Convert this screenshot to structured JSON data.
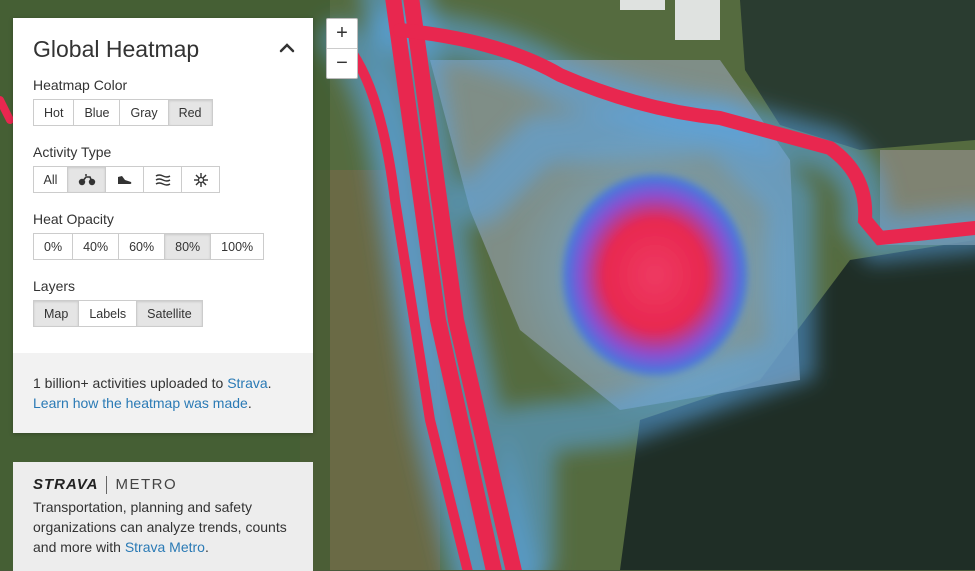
{
  "panel": {
    "title": "Global Heatmap",
    "heatmap_color": {
      "label": "Heatmap Color",
      "options": [
        "Hot",
        "Blue",
        "Gray",
        "Red"
      ],
      "selected": "Red"
    },
    "activity_type": {
      "label": "Activity Type",
      "options": [
        {
          "label": "All",
          "icon": null
        },
        {
          "label": "",
          "icon": "bike-icon"
        },
        {
          "label": "",
          "icon": "shoe-icon"
        },
        {
          "label": "",
          "icon": "water-icon"
        },
        {
          "label": "",
          "icon": "snowflake-icon"
        }
      ],
      "selected_icon": "bike-icon"
    },
    "heat_opacity": {
      "label": "Heat Opacity",
      "options": [
        "0%",
        "40%",
        "60%",
        "80%",
        "100%"
      ],
      "selected": "80%"
    },
    "layers": {
      "label": "Layers",
      "options": [
        "Map",
        "Labels",
        "Satellite"
      ],
      "selected": [
        "Map",
        "Satellite"
      ]
    },
    "footer": {
      "text_before": "1 billion+ activities uploaded to ",
      "strava_link": "Strava",
      "period": ".",
      "learn_link": "Learn how the heatmap was made",
      "period2": "."
    }
  },
  "metro": {
    "strava": "STRAVA",
    "metro": "METRO",
    "text": "Transportation, planning and safety organizations can analyze trends, counts and more with ",
    "link": "Strava Metro",
    "period": "."
  },
  "zoom": {
    "in": "+",
    "out": "−"
  },
  "colors": {
    "heat": "#e8274f",
    "heat_glow": "#3b8fe0",
    "link": "#2a7ab5"
  }
}
